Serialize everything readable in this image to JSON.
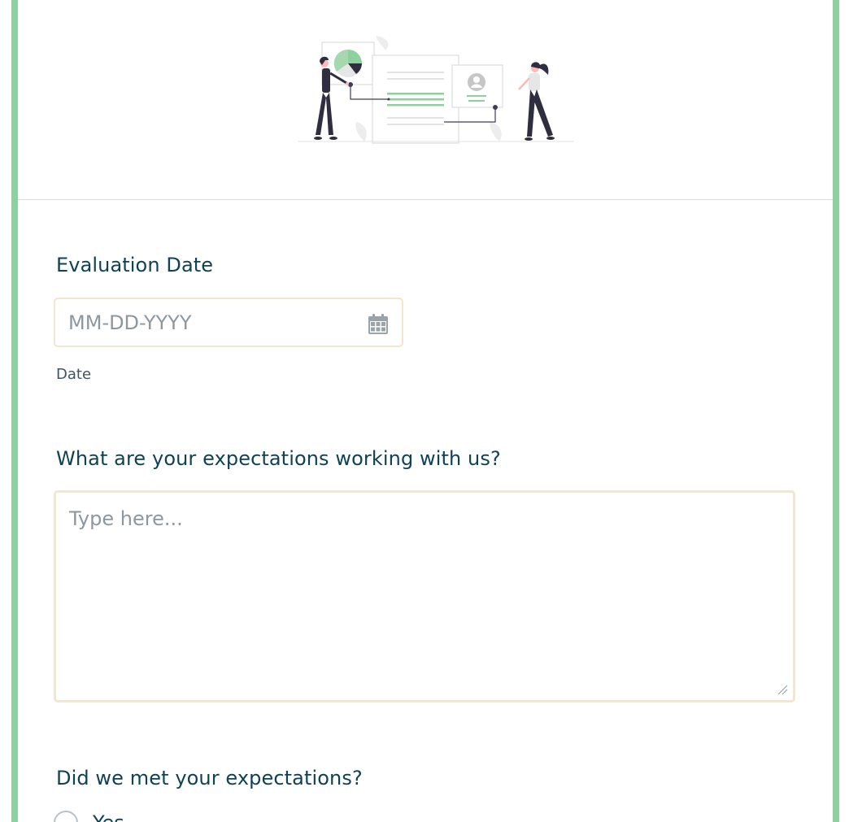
{
  "form": {
    "evaluation_date": {
      "label": "Evaluation Date",
      "placeholder": "MM-DD-YYYY",
      "sublabel": "Date",
      "icon": "calendar-icon"
    },
    "expectations_question": {
      "label": "What are your expectations working with us?",
      "placeholder": "Type here..."
    },
    "met_expectations": {
      "label": "Did we met your expectations?",
      "options": [
        "Yes"
      ]
    }
  },
  "colors": {
    "frame_border": "#8fd19e",
    "label_text": "#0f4256",
    "input_border": "#f1e6cf",
    "placeholder": "#8d979f",
    "illustration_accent": "#8fd19e",
    "illustration_dark": "#2f2e41"
  }
}
